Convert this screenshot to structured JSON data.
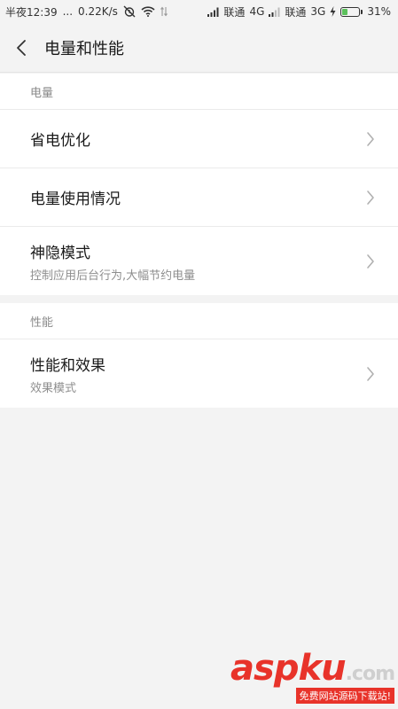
{
  "status_bar": {
    "time": "半夜12:39",
    "dots": "...",
    "speed": "0.22K/s",
    "carrier1": "联通",
    "network1": "4G",
    "carrier2": "联通",
    "network2": "3G",
    "battery": "31%",
    "battery_level": 0.31,
    "battery_color": "#5cc15c",
    "icons": [
      "alarm-off-icon",
      "wifi-icon",
      "data-transfer-icon",
      "signal-icon",
      "signal-icon",
      "charging-icon",
      "battery-icon"
    ]
  },
  "header": {
    "title": "电量和性能"
  },
  "sections": [
    {
      "header": "电量",
      "items": [
        {
          "title": "省电优化"
        },
        {
          "title": "电量使用情况"
        },
        {
          "title": "神隐模式",
          "subtitle": "控制应用后台行为,大幅节约电量"
        }
      ]
    },
    {
      "header": "性能",
      "items": [
        {
          "title": "性能和效果",
          "subtitle": "效果模式"
        }
      ]
    }
  ],
  "watermark": {
    "main": "aspku",
    "suffix": ".com",
    "sub": "免费网站源码下载站!"
  }
}
